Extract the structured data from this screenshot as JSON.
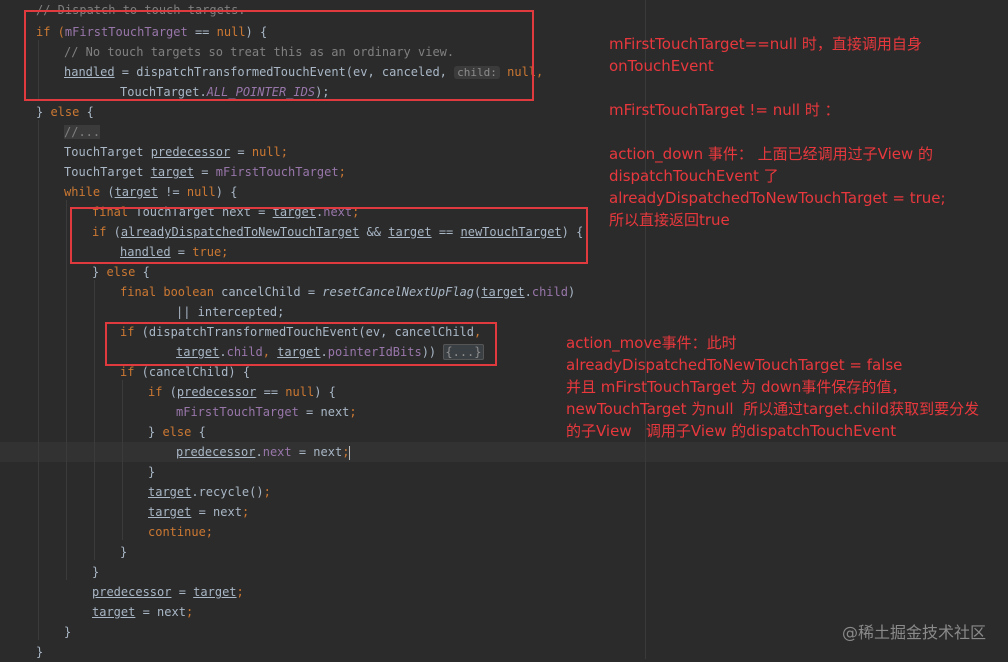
{
  "code": {
    "l0": "// Dispatch to touch targets.",
    "l1a": "if (",
    "l1b": "mFirstTouchTarget",
    "l1c": " == ",
    "l1d": "null",
    "l1e": ") {",
    "l2": "// No touch targets so treat this as an ordinary view.",
    "l3a": "handled",
    "l3b": " = dispatchTransformedTouchEvent(ev, canceled, ",
    "l3hint": "child:",
    "l3c": " null",
    "l3d": ",",
    "l4a": "TouchTarget.",
    "l4b": "ALL_POINTER_IDS",
    "l4c": ");",
    "l5a": "} ",
    "l5b": "else",
    "l5c": " {",
    "l6": "//...",
    "l7a": "TouchTarget ",
    "l7b": "predecessor",
    "l7c": " = ",
    "l7d": "null",
    "l7e": ";",
    "l8a": "TouchTarget ",
    "l8b": "target",
    "l8c": " = ",
    "l8d": "mFirstTouchTarget",
    "l8e": ";",
    "l9a": "while",
    "l9b": " (",
    "l9c": "target",
    "l9d": " != ",
    "l9e": "null",
    "l9f": ") {",
    "l10a": "final",
    "l10b": " TouchTarget next = ",
    "l10c": "target",
    "l10d": ".",
    "l10e": "next",
    "l10f": ";",
    "l11a": "if",
    "l11b": " (",
    "l11c": "alreadyDispatchedToNewTouchTarget",
    "l11d": " && ",
    "l11e": "target",
    "l11f": " == ",
    "l11g": "newTouchTarget",
    "l11h": ") {",
    "l12a": "handled",
    "l12b": " = ",
    "l12c": "true",
    "l12d": ";",
    "l13a": "} ",
    "l13b": "else",
    "l13c": " {",
    "l14a": "final boolean",
    "l14b": " cancelChild = ",
    "l14c": "resetCancelNextUpFlag",
    "l14d": "(",
    "l14e": "target",
    "l14f": ".",
    "l14g": "child",
    "l14h": ")",
    "l15": "|| intercepted;",
    "l16a": "if",
    "l16b": " (dispatchTransformedTouchEvent(ev, cancelChild",
    "l16c": ",",
    "l17a": "target",
    "l17b": ".",
    "l17c": "child",
    "l17d": ", ",
    "l17e": "target",
    "l17f": ".",
    "l17g": "pointerIdBits",
    "l17h": ")) ",
    "l17i": "{...}",
    "l18a": "if",
    "l18b": " (cancelChild) {",
    "l19a": "if",
    "l19b": " (",
    "l19c": "predecessor",
    "l19d": " == ",
    "l19e": "null",
    "l19f": ") {",
    "l20a": "mFirstTouchTarget",
    "l20b": " = next",
    "l20c": ";",
    "l21a": "} ",
    "l21b": "else",
    "l21c": " {",
    "l22a": "predecessor",
    "l22b": ".",
    "l22c": "next",
    "l22d": " = next",
    "l22e": ";",
    "l23": "}",
    "l24a": "target",
    "l24b": ".recycle()",
    "l24c": ";",
    "l25a": "target",
    "l25b": " = next",
    "l25c": ";",
    "l26a": "continue",
    "l26b": ";",
    "l27": "}",
    "l28": "}",
    "l29a": "predecessor",
    "l29b": " = ",
    "l29c": "target",
    "l29d": ";",
    "l30a": "target",
    "l30b": " = next",
    "l30c": ";",
    "l31": "}",
    "l32": "}"
  },
  "annotations": {
    "note1": "mFirstTouchTarget==null 时，直接调用自身\nonTouchEvent\n\nmFirstTouchTarget != null 时 ：\n\naction_down 事件： 上面已经调用过子View 的\ndispatchTouchEvent 了\nalreadyDispatchedToNewTouchTarget = true;\n所以直接返回true",
    "note2": "action_move事件：此时\nalreadyDispatchedToNewTouchTarget = false\n并且 mFirstTouchTarget 为 down事件保存的值，\nnewTouchTarget 为null  所以通过target.child获取到要分发\n的子View   调用子View 的dispatchTouchEvent"
  },
  "watermark": "@稀土掘金技术社区",
  "colors": {
    "background": "#2b2b2b",
    "keyword": "#cc7832",
    "field": "#9876aa",
    "comment": "#808080",
    "text": "#a9b7c6",
    "annotation": "#e8383d"
  }
}
